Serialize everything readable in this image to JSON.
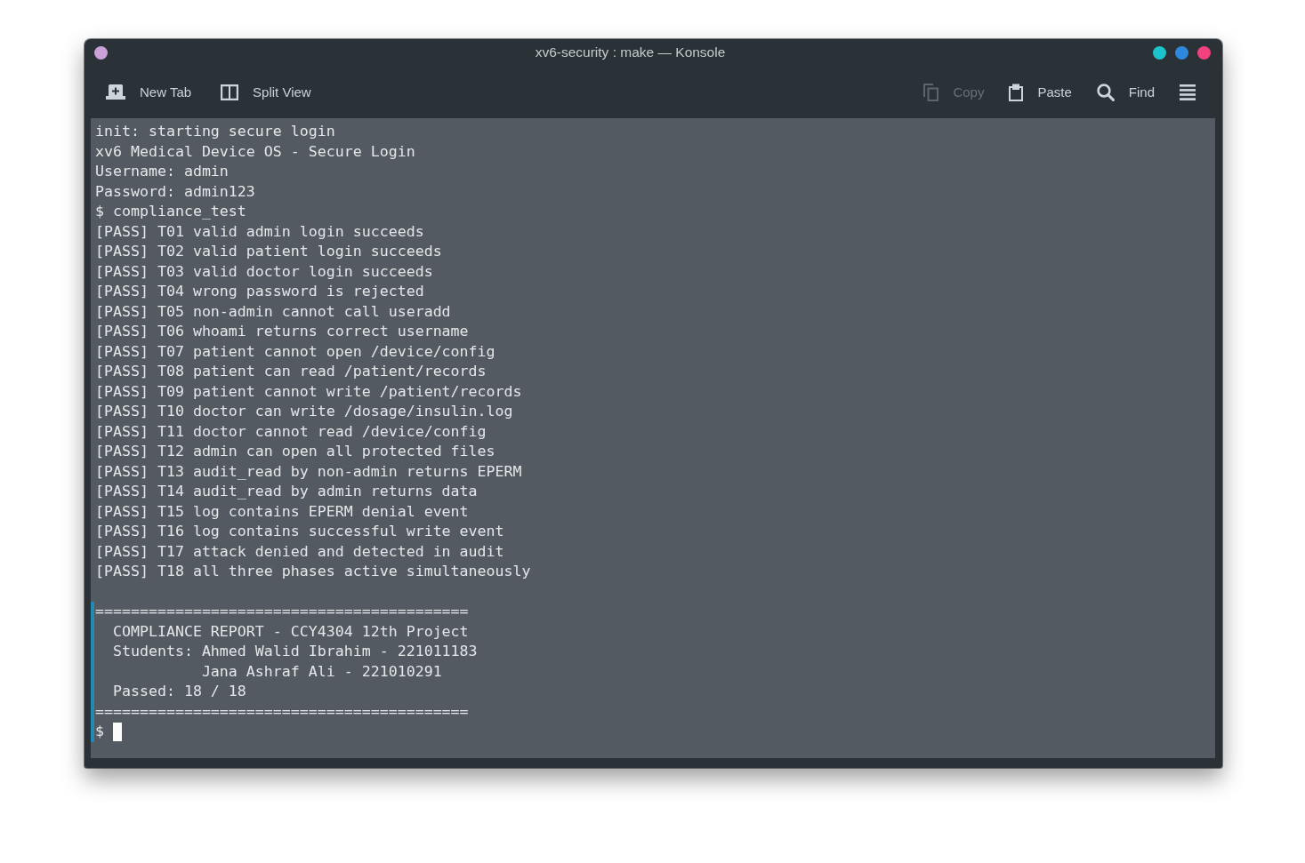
{
  "window": {
    "title": "xv6-security : make — Konsole",
    "left_buttons": [
      {
        "color": "#c8a2d8"
      }
    ],
    "right_buttons": [
      {
        "color": "#1ec4cb"
      },
      {
        "color": "#2d88de"
      },
      {
        "color": "#f2417f"
      }
    ]
  },
  "toolbar": {
    "left": [
      {
        "kind": "add",
        "label": "New Tab",
        "disabled": false
      },
      {
        "kind": "split",
        "label": "Split View",
        "disabled": false
      }
    ],
    "right": [
      {
        "kind": "copy",
        "label": "Copy",
        "disabled": true
      },
      {
        "kind": "paste",
        "label": "Paste",
        "disabled": false
      },
      {
        "kind": "search",
        "label": "Find",
        "disabled": false
      },
      {
        "kind": "menu",
        "disabled": false
      }
    ]
  },
  "terminal": {
    "blocks": [
      {
        "highlighted": false,
        "lines": [
          "init: starting secure login",
          "xv6 Medical Device OS - Secure Login",
          "Username: admin",
          "Password: admin123",
          "$ compliance_test",
          "[PASS] T01 valid admin login succeeds",
          "[PASS] T02 valid patient login succeeds",
          "[PASS] T03 valid doctor login succeeds",
          "[PASS] T04 wrong password is rejected",
          "[PASS] T05 non-admin cannot call useradd",
          "[PASS] T06 whoami returns correct username",
          "[PASS] T07 patient cannot open /device/config",
          "[PASS] T08 patient can read /patient/records",
          "[PASS] T09 patient cannot write /patient/records",
          "[PASS] T10 doctor can write /dosage/insulin.log",
          "[PASS] T11 doctor cannot read /device/config",
          "[PASS] T12 admin can open all protected files",
          "[PASS] T13 audit_read by non-admin returns EPERM",
          "[PASS] T14 audit_read by admin returns data",
          "[PASS] T15 log contains EPERM denial event",
          "[PASS] T16 log contains successful write event",
          "[PASS] T17 attack denied and detected in audit",
          "[PASS] T18 all three phases active simultaneously"
        ]
      },
      {
        "highlighted": true,
        "lines": [
          "==========================================",
          "  COMPLIANCE REPORT - CCY4304 12th Project",
          "  Students: Ahmed Walid Ibrahim - 221011183",
          "            Jana Ashraf Ali - 221010291",
          "  Passed: 18 / 18",
          "=========================================="
        ]
      }
    ],
    "prompt": "$",
    "cursor_visible": true
  }
}
